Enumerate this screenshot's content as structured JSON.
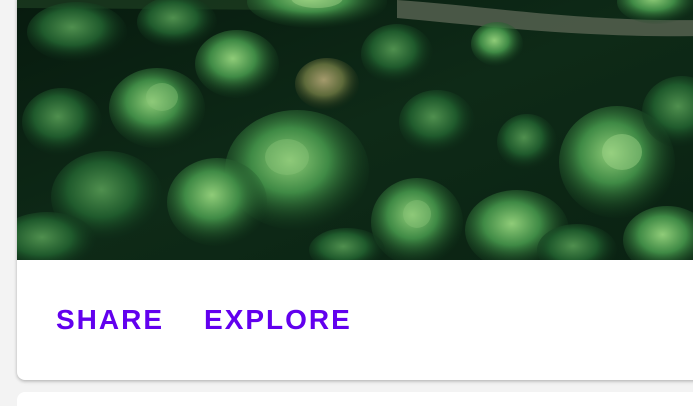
{
  "card": {
    "image": {
      "subject": "aerial-forest-image",
      "colors": {
        "shadow": "#06150c",
        "dark": "#0f2e19",
        "mid": "#1f5a2c",
        "light": "#3e8a43",
        "highlight": "#7dbf6a",
        "path": "#5f6a59"
      }
    },
    "actions": {
      "share_label": "SHARE",
      "explore_label": "EXPLORE"
    },
    "accent_color": "#6200ee"
  }
}
